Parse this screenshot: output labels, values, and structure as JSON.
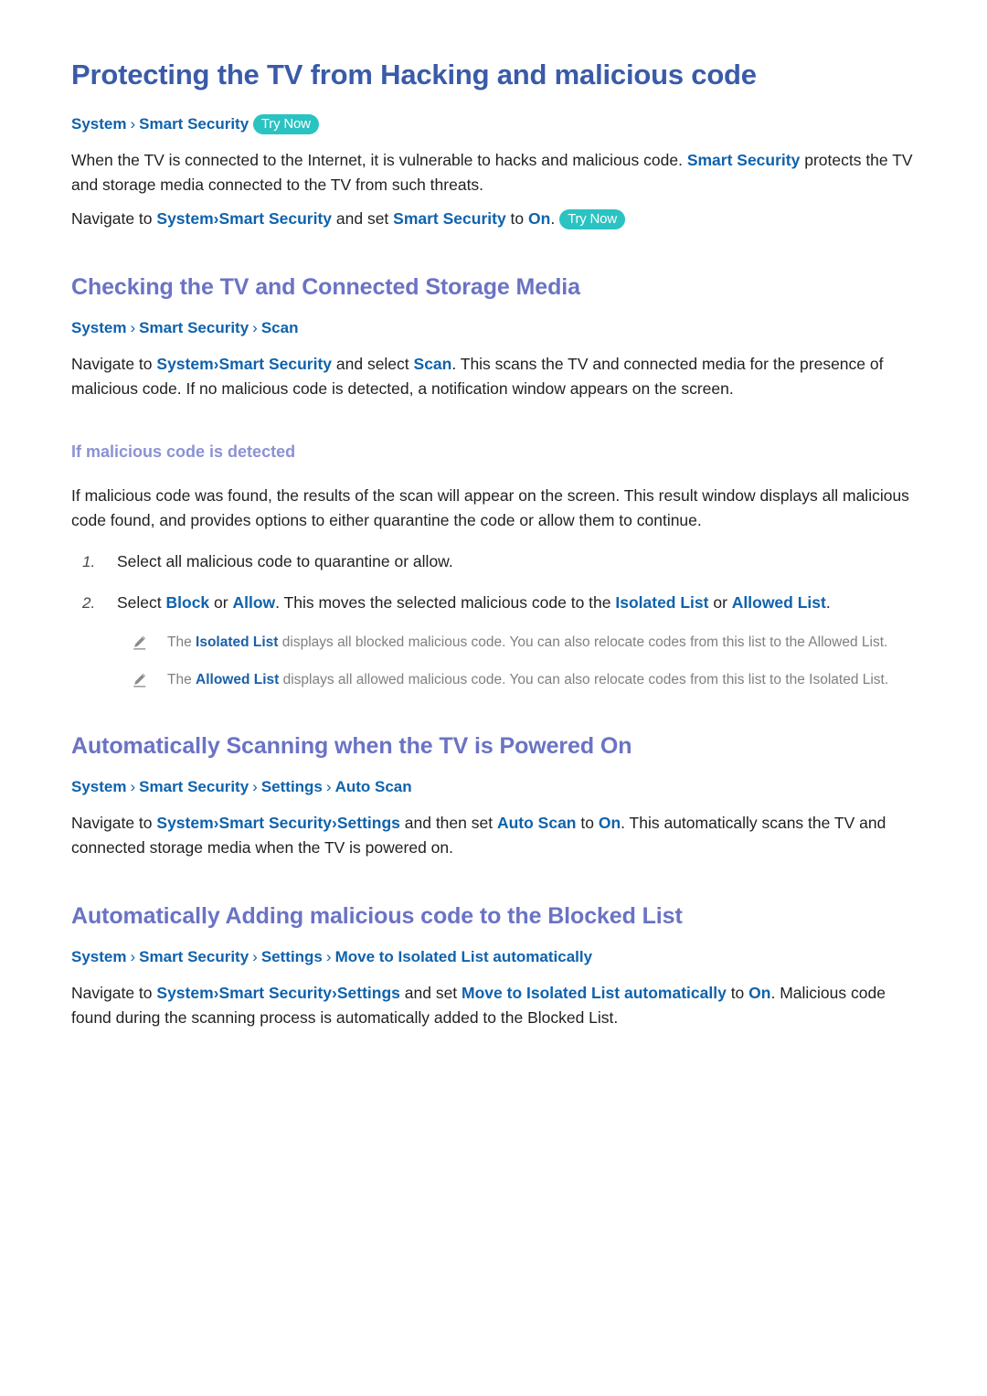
{
  "page": {
    "title": "Protecting the TV from Hacking and malicious code",
    "background": "#ffffff"
  },
  "colors": {
    "h1": "#3a5ba8",
    "h2": "#6a73c4",
    "h3": "#8b92d4",
    "link": "#0f62ac",
    "body_text": "#231f20",
    "note_text": "#808080",
    "badge_bg": "#2bc2c2",
    "badge_text": "#ffffff"
  },
  "intro": {
    "breadcrumb": {
      "crumbs": [
        "System",
        "Smart Security"
      ],
      "separator": "›",
      "badge": "Try Now"
    },
    "para1": {
      "t1": "When the TV is connected to the Internet, it is vulnerable to hacks and malicious code. ",
      "l1": "Smart Security",
      "t2": " protects the TV and storage media connected to the TV from such threats."
    },
    "para2": {
      "t1": "Navigate to ",
      "l1": "System",
      "sep": "›",
      "l2": "Smart Security",
      "t2": " and set ",
      "l3": "Smart Security",
      "t3": " to ",
      "l4": "On",
      "t4": ".",
      "badge": "Try Now"
    }
  },
  "section_checking": {
    "heading": "Checking the TV and Connected Storage Media",
    "breadcrumb": {
      "crumbs": [
        "System",
        "Smart Security",
        "Scan"
      ],
      "separator": "›"
    },
    "para": {
      "t1": "Navigate to ",
      "l1": "System",
      "sep": "›",
      "l2": "Smart Security",
      "t2": " and select ",
      "l3": "Scan",
      "t3": ". This scans the TV and connected media for the presence of malicious code. If no malicious code is detected, a notification window appears on the screen."
    },
    "subsection": {
      "heading": "If malicious code is detected",
      "para": "If malicious code was found, the results of the scan will appear on the screen. This result window displays all malicious code found, and provides options to either quarantine the code or allow them to continue.",
      "steps": [
        {
          "num": "1.",
          "t1": "Select all malicious code to quarantine or allow."
        },
        {
          "num": "2.",
          "t1": "Select ",
          "l1": "Block",
          "t2": " or ",
          "l2": "Allow",
          "t3": ". This moves the selected malicious code to the ",
          "l3": "Isolated List",
          "t4": " or ",
          "l4": "Allowed List",
          "t5": "."
        }
      ],
      "notes": [
        {
          "icon": "pencil-icon",
          "t1": "The ",
          "l1": "Isolated List",
          "t2": " displays all blocked malicious code. You can also relocate codes from this list to the Allowed List."
        },
        {
          "icon": "pencil-icon",
          "t1": "The ",
          "l1": "Allowed List",
          "t2": " displays all allowed malicious code. You can also relocate codes from this list to the Isolated List."
        }
      ]
    }
  },
  "section_autoscan": {
    "heading": "Automatically Scanning when the TV is Powered On",
    "breadcrumb": {
      "crumbs": [
        "System",
        "Smart Security",
        "Settings",
        "Auto Scan"
      ],
      "separator": "›"
    },
    "para": {
      "t1": "Navigate to ",
      "l1": "System",
      "sep": "›",
      "l2": "Smart Security",
      "sep2": "›",
      "l3": "Settings",
      "t2": " and then set ",
      "l4": "Auto Scan",
      "t3": " to ",
      "l5": "On",
      "t4": ". This automatically scans the TV and connected storage media when the TV is powered on."
    }
  },
  "section_blocked": {
    "heading": "Automatically Adding malicious code to the Blocked List",
    "breadcrumb": {
      "crumbs": [
        "System",
        "Smart Security",
        "Settings",
        "Move to Isolated List automatically"
      ],
      "separator": "›"
    },
    "para": {
      "t1": "Navigate to ",
      "l1": "System",
      "sep": "›",
      "l2": "Smart Security",
      "sep2": "›",
      "l3": "Settings",
      "t2": " and set ",
      "l4": "Move to Isolated List automatically",
      "t3": " to ",
      "l5": "On",
      "t4": ". Malicious code found during the scanning process is automatically added to the Blocked List."
    }
  }
}
